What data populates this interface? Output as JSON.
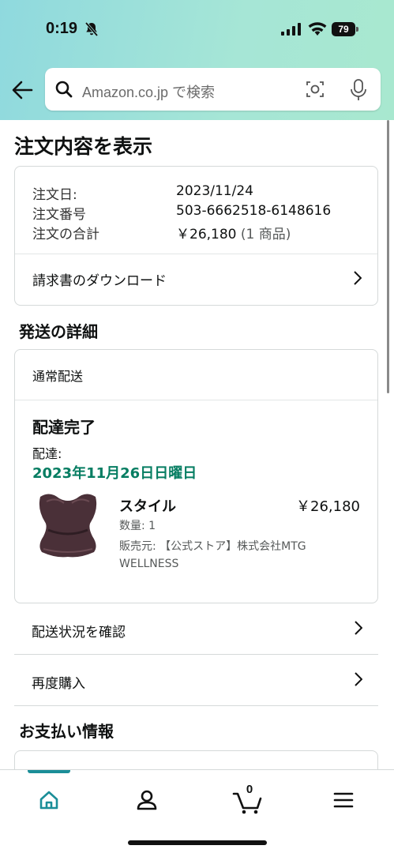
{
  "status_bar": {
    "time": "0:19",
    "battery": "79"
  },
  "search": {
    "placeholder": "Amazon.co.jp で検索"
  },
  "page_title": "注文内容を表示",
  "order_summary": {
    "date_label": "注文日:",
    "date_value": "2023/11/24",
    "number_label": "注文番号",
    "number_value": "503-6662518-6148616",
    "total_label": "注文の合計",
    "total_value": "￥26,180",
    "total_count": "(1 商品)",
    "invoice_link": "請求書のダウンロード"
  },
  "shipping": {
    "section_title": "発送の詳細",
    "type": "通常配送",
    "status": "配達完了",
    "delivery_label": "配達:",
    "delivery_date": "2023年11月26日日曜日",
    "product": {
      "name": "スタイル",
      "price": "￥26,180",
      "quantity": "数量: 1",
      "seller": "販売元: 【公式ストア】株式会社MTG WELLNESS"
    }
  },
  "actions": {
    "track": "配送状況を確認",
    "rebuy": "再度購入"
  },
  "payment": {
    "section_title": "お支払い情報"
  },
  "tabbar": {
    "cart_count": "0",
    "items": [
      "home-icon",
      "account-icon",
      "cart-icon",
      "menu-icon"
    ],
    "accent": "#1b8e98"
  },
  "colors": {
    "delivered_green": "#067d62",
    "border": "#d5d9d9"
  }
}
